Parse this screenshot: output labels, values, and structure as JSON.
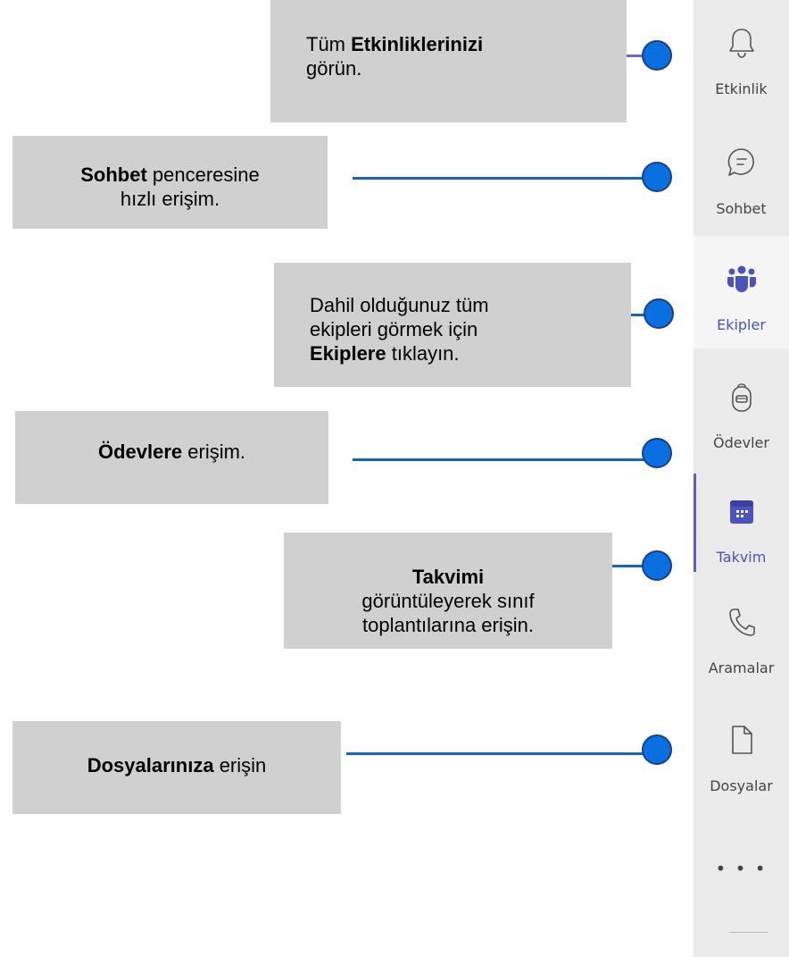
{
  "callouts": {
    "activity": {
      "pre": "Tüm ",
      "bold": "Etkinliklerinizi",
      "post": "görün."
    },
    "chat": {
      "bold": "Sohbet",
      "post": " penceresine",
      "line2": "hızlı erişim."
    },
    "teams": {
      "line1": "Dahil olduğunuz tüm",
      "line2": "ekipleri görmek için",
      "bold": "Ekiplere",
      "post": " tıklayın."
    },
    "assignments": {
      "bold": "Ödevlere",
      "post": " erişim."
    },
    "calendar": {
      "bold": "Takvimi",
      "line2": "görüntüleyerek sınıf",
      "line3": "toplantılarına erişin."
    },
    "files": {
      "bold": "Dosyalarınıza",
      "post": " erişin"
    }
  },
  "sidebar": {
    "items": [
      {
        "label": "Etkinlik",
        "icon": "bell-icon"
      },
      {
        "label": "Sohbet",
        "icon": "chat-icon"
      },
      {
        "label": "Ekipler",
        "icon": "teams-icon"
      },
      {
        "label": "Ödevler",
        "icon": "backpack-icon"
      },
      {
        "label": "Takvim",
        "icon": "calendar-icon"
      },
      {
        "label": "Aramalar",
        "icon": "phone-icon"
      },
      {
        "label": "Dosyalar",
        "icon": "file-icon"
      }
    ],
    "more": "• • •"
  },
  "colors": {
    "callout_bg": "#d0d0d0",
    "dot": "#0a70e0",
    "line_blue": "#1565c0",
    "line_purple": "#7b5fc4",
    "accent": "#5b5fc7"
  }
}
